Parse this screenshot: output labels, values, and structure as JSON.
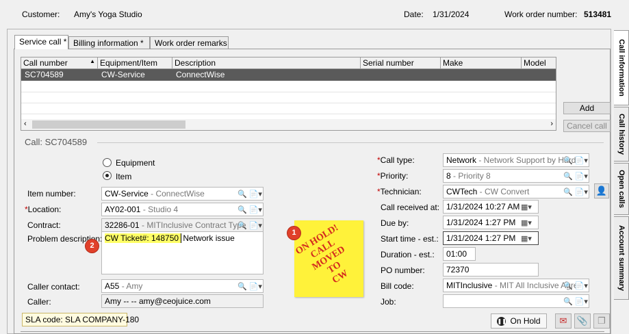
{
  "header": {
    "customer_label": "Customer:",
    "customer_value": "Amy's Yoga Studio",
    "date_label": "Date:",
    "date_value": "1/31/2024",
    "work_order_label": "Work order number:",
    "work_order_value": "513481"
  },
  "tabs": [
    "Service call *",
    "Billing information *",
    "Work order remarks"
  ],
  "side_tabs": [
    "Call information",
    "Call history",
    "Open calls",
    "Account summary"
  ],
  "grid": {
    "columns": [
      "Call number",
      "Equipment/Item",
      "Description",
      "Serial number",
      "Make",
      "Model"
    ],
    "rows": [
      {
        "call_number": "SC704589",
        "equipment": "CW-Service",
        "description": "ConnectWise",
        "serial": "",
        "make": "",
        "model": ""
      }
    ],
    "add_label": "Add",
    "cancel_label": "Cancel call"
  },
  "call": {
    "section_title": "Call: SC704589",
    "radio_equipment": "Equipment",
    "radio_item": "Item",
    "item_number_label": "Item number:",
    "item_number_code": "CW-Service",
    "item_number_desc": " - ConnectWise",
    "location_label": "Location:",
    "location_code": "AY02-001",
    "location_desc": " - Studio 4",
    "contract_label": "Contract:",
    "contract_code": "32286-01",
    "contract_desc": " - MITInclusive Contract Type",
    "problem_label": "Problem description:",
    "problem_highlight": "CW Ticket#: 148750 ",
    "problem_rest": "Network issue",
    "caller_contact_label": "Caller contact:",
    "caller_contact_code": "A55",
    "caller_contact_desc": " - Amy",
    "caller_label": "Caller:",
    "caller_value": "Amy  --  -- amy@ceojuice.com",
    "sla_text": "SLA code: SLA COMPANY-180",
    "call_type_label": "Call type:",
    "call_type_code": "Network",
    "call_type_desc": " - Network Support by Hard",
    "priority_label": "Priority:",
    "priority_code": "8",
    "priority_desc": " - Priority 8",
    "technician_label": "Technician:",
    "technician_code": "CWTech",
    "technician_desc": " - CW Convert",
    "received_label": "Call received at:",
    "received_value": "1/31/2024 10:27 AM",
    "due_label": "Due by:",
    "due_value": "1/31/2024   1:27 PM",
    "start_label": "Start time - est.:",
    "start_value": "1/31/2024   1:27 PM",
    "duration_label": "Duration - est.:",
    "duration_value": "01:00",
    "po_label": "PO number:",
    "po_value": "72370",
    "bill_label": "Bill code:",
    "bill_code": "MITInclusive",
    "bill_desc": " - MIT All Inclusive Agre",
    "job_label": "Job:",
    "job_value": "",
    "on_hold_label": "On Hold"
  },
  "sticky_note": [
    "ON HOLD!",
    "CALL",
    "MOVED",
    "TO",
    "CW"
  ],
  "badges": [
    "1",
    "2"
  ],
  "colors": {
    "selected_row": "#5a5a5a",
    "highlight": "#ffff66",
    "sticky": "#fff23a",
    "sticky_text": "#d32a1e",
    "badge": "#e0402a",
    "required": "#c00000"
  },
  "icons": {
    "lookup": "magnifier-icon",
    "dropdown": "doc-dropdown-icon",
    "calendar": "calendar-icon",
    "technician": "technician-lookup-icon",
    "email": "email-icon",
    "attach": "paperclip-icon",
    "copy": "copy-icon",
    "on_hold": "on-hold-icon"
  }
}
